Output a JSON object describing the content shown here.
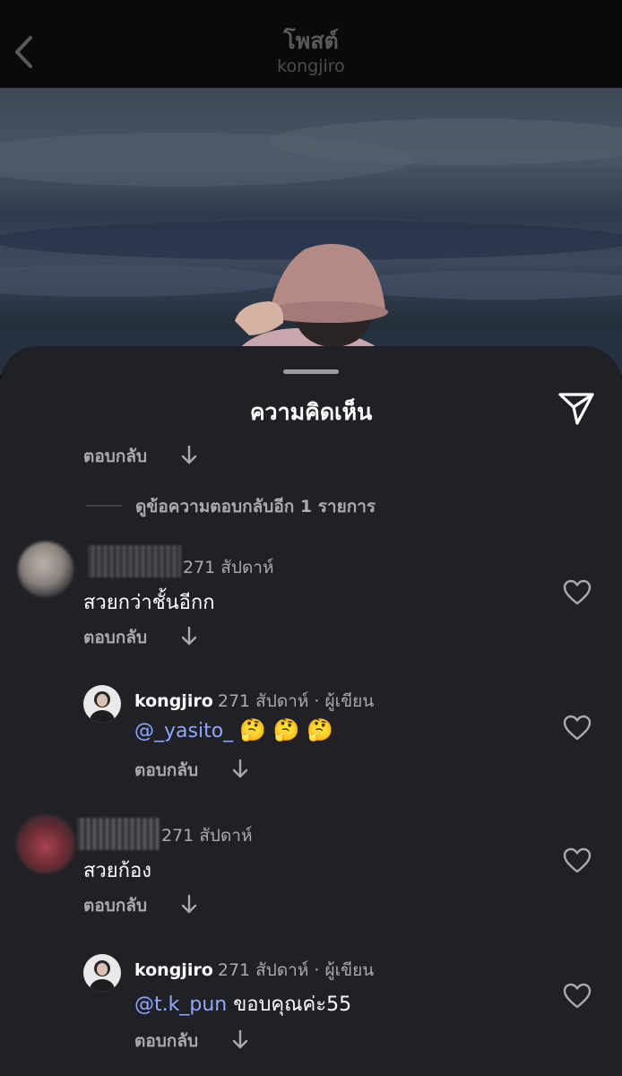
{
  "header": {
    "title": "โพสต์",
    "subtitle": "kongjiro"
  },
  "sheet": {
    "title": "ความคิดเห็น",
    "reply_label": "ตอบกลับ",
    "view_more_replies": "ดูข้อความตอบกลับอีก 1 รายการ"
  },
  "comments": [
    {
      "username_visible": "",
      "meta": "271 สัปดาห์",
      "text": "สวยกว่าชั้นอีกก"
    },
    {
      "username": "kongjiro",
      "meta": "271 สัปดาห์ · ผู้เขียน",
      "mention": "@_yasito_",
      "emoji": "🤔 🤔 🤔"
    },
    {
      "username_visible": "",
      "meta": "271 สัปดาห์",
      "text": "สวยก้อง"
    },
    {
      "username": "kongjiro",
      "meta": "271 สัปดาห์ · ผู้เขียน",
      "mention": "@t.k_pun",
      "text": " ขอบคุณค่ะ55"
    }
  ],
  "colors": {
    "sheet_bg": "#202126",
    "mention": "#8fa8ff",
    "muted_text": "#a9abb0"
  },
  "icons": [
    "back-chevron-icon",
    "send-icon",
    "heart-icon",
    "down-arrow-icon"
  ]
}
